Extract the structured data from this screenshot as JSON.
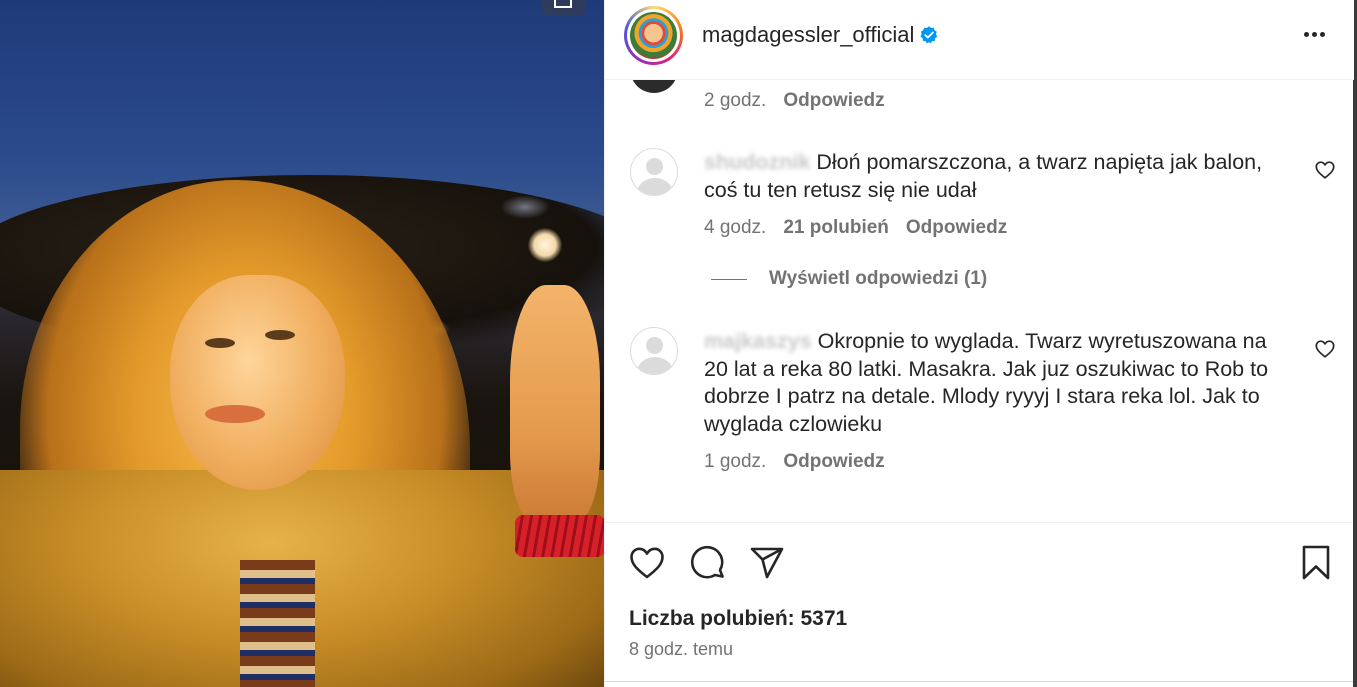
{
  "post": {
    "username": "magdagessler_official",
    "verified": true
  },
  "comments": {
    "previous": {
      "time": "2 godz.",
      "reply_label": "Odpowiedz"
    },
    "items": [
      {
        "username": "shudoznik",
        "text": "Dłoń pomarszczona, a twarz napięta jak balon, coś tu ten retusz się nie udał",
        "time": "4 godz.",
        "likes": "21 polubień",
        "reply_label": "Odpowiedz",
        "view_replies": "Wyświetl odpowiedzi (1)"
      },
      {
        "username": "majkaszys",
        "text": "Okropnie to wyglada. Twarz wyretuszowana na 20 lat a reka 80 latki. Masakra. Jak juz oszukiwac to Rob to dobrze I patrz na detale. Mlody ryyyj I stara reka lol. Jak to wyglada czlowieku",
        "time": "1 godz.",
        "reply_label": "Odpowiedz"
      }
    ]
  },
  "footer": {
    "likes": "Liczba polubień: 5371",
    "time_ago": "8 godz. temu"
  },
  "colors": {
    "text": "#262626",
    "secondary": "#737373",
    "verified": "#0095f6",
    "divider": "#efefef"
  },
  "icons": [
    "carousel-icon",
    "verified-badge-icon",
    "more-options-icon",
    "heart-icon",
    "comment-icon",
    "share-icon",
    "bookmark-icon"
  ]
}
